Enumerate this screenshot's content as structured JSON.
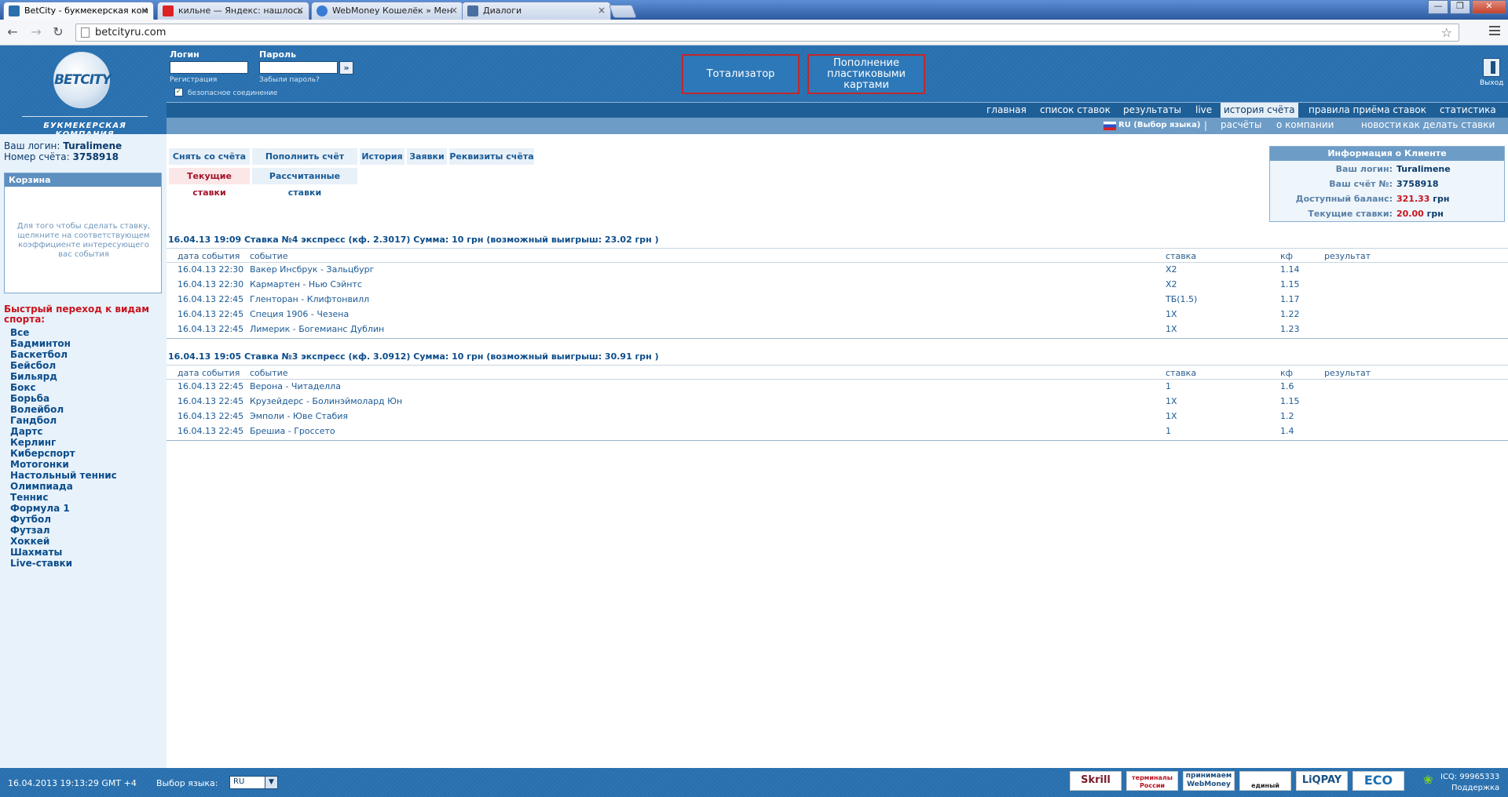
{
  "browser": {
    "tabs": [
      {
        "title": "BetCity - букмекерская ком",
        "favicon_color": "#2a6fac"
      },
      {
        "title": "кильне — Яндекс: нашлось",
        "favicon_color": "#d22"
      },
      {
        "title": "WebMoney Кошелёк » Мен",
        "favicon_color": "#3a7bd5"
      },
      {
        "title": "Диалоги",
        "favicon_color": "#4a6fa0"
      }
    ],
    "close_symbol": "×",
    "url": "betcityru.com",
    "window_buttons": [
      "—",
      "❐",
      "✕"
    ]
  },
  "header": {
    "logo_text": "BETCITY",
    "logo_subtitle": "БУКМЕКЕРСКАЯ КОМПАНИЯ",
    "login_label": "Логин",
    "password_label": "Пароль",
    "register_link": "Регистрация",
    "forgot_link": "Забыли пароль?",
    "go_symbol": "»",
    "secure_label": "безопасное соединение",
    "check_symbol": "✓",
    "btn_totalizator": "Тотализатор",
    "btn_topup": "Пополнение пластиковыми картами",
    "exit_label": "Выход"
  },
  "nav1": [
    "главная",
    "список ставок",
    "результаты",
    "live",
    "история счёта",
    "правила приёма ставок",
    "статистика"
  ],
  "nav2": {
    "lang": "RU (Выбор языка)",
    "sep": "|",
    "items": [
      "расчёты",
      "о компании",
      "новости",
      "как делать ставки"
    ]
  },
  "sidebar": {
    "login_prefix": "Ваш логин:",
    "login": "Turalimene",
    "account_prefix": "Номер счёта:",
    "account": "3758918",
    "basket_title": "Корзина",
    "basket_text": "Для того чтобы сделать ставку, щелкните на соответствующем коэффициенте интересующего вас события",
    "quick_title": "Быстрый переход к видам спорта:",
    "sports": [
      "Все",
      "Бадминтон",
      "Баскетбол",
      "Бейсбол",
      "Бильярд",
      "Бокс",
      "Борьба",
      "Волейбол",
      "Гандбол",
      "Дартс",
      "Керлинг",
      "Киберспорт",
      "Мотогонки",
      "Настольный теннис",
      "Олимпиада",
      "Теннис",
      "Формула 1",
      "Футбол",
      "Футзал",
      "Хоккей",
      "Шахматы",
      "Live-ставки"
    ]
  },
  "account_tabs": {
    "withdraw": "Снять со счёта",
    "deposit": "Пополнить счёт",
    "history": "История",
    "requests": "Заявки",
    "details": "Реквизиты счёта",
    "current": "Текущие ставки",
    "settled": "Рассчитанные ставки"
  },
  "client_info": {
    "title": "Информация о Клиенте",
    "login_k": "Ваш логин:",
    "login_v": "Turalimene",
    "acc_k": "Ваш счёт №:",
    "acc_v": "3758918",
    "bal_k": "Доступный баланс:",
    "bal_v": "321.33",
    "cur_k": "Текущие ставки:",
    "cur_v": "20.00",
    "unit": "грн"
  },
  "table_headers": [
    "дата события",
    "событие",
    "ставка",
    "кф",
    "результат"
  ],
  "bets": [
    {
      "header": "16.04.13 19:09  Ставка №4  экспресс (кф. 2.3017)   Сумма: 10 грн (возможный выигрыш: 23.02 грн )",
      "rows": [
        [
          "16.04.13 22:30",
          "Вакер Инсбрук - Зальцбург",
          "X2",
          "1.14"
        ],
        [
          "16.04.13 22:30",
          "Кармартен - Нью Сэйнтс",
          "X2",
          "1.15"
        ],
        [
          "16.04.13 22:45",
          "Гленторан - Клифтонвилл",
          "ТБ(1.5)",
          "1.17"
        ],
        [
          "16.04.13 22:45",
          "Специя 1906 - Чезена",
          "1X",
          "1.22"
        ],
        [
          "16.04.13 22:45",
          "Лимерик - Богемианс Дублин",
          "1X",
          "1.23"
        ]
      ]
    },
    {
      "header": "16.04.13 19:05  Ставка №3  экспресс (кф. 3.0912)   Сумма: 10 грн (возможный выигрыш: 30.91 грн )",
      "rows": [
        [
          "16.04.13 22:45",
          "Верона - Читаделла",
          "1",
          "1.6"
        ],
        [
          "16.04.13 22:45",
          "Крузейдерс - Болинэймолард Юн",
          "1X",
          "1.15"
        ],
        [
          "16.04.13 22:45",
          "Эмполи - Юве Стабия",
          "1X",
          "1.2"
        ],
        [
          "16.04.13 22:45",
          "Брешиа - Гроссето",
          "1",
          "1.4"
        ]
      ]
    }
  ],
  "footer": {
    "time": "16.04.2013  19:13:29  GMT +4",
    "lang_label": "Выбор языка:",
    "lang_value": "RU",
    "payments": [
      "Skrill",
      "терминалы России",
      "принимаем WebMoney",
      "единый кошелёк",
      "LiQPAY",
      "ECO"
    ],
    "icq": "ICQ: 99965333",
    "support": "Поддержка"
  }
}
